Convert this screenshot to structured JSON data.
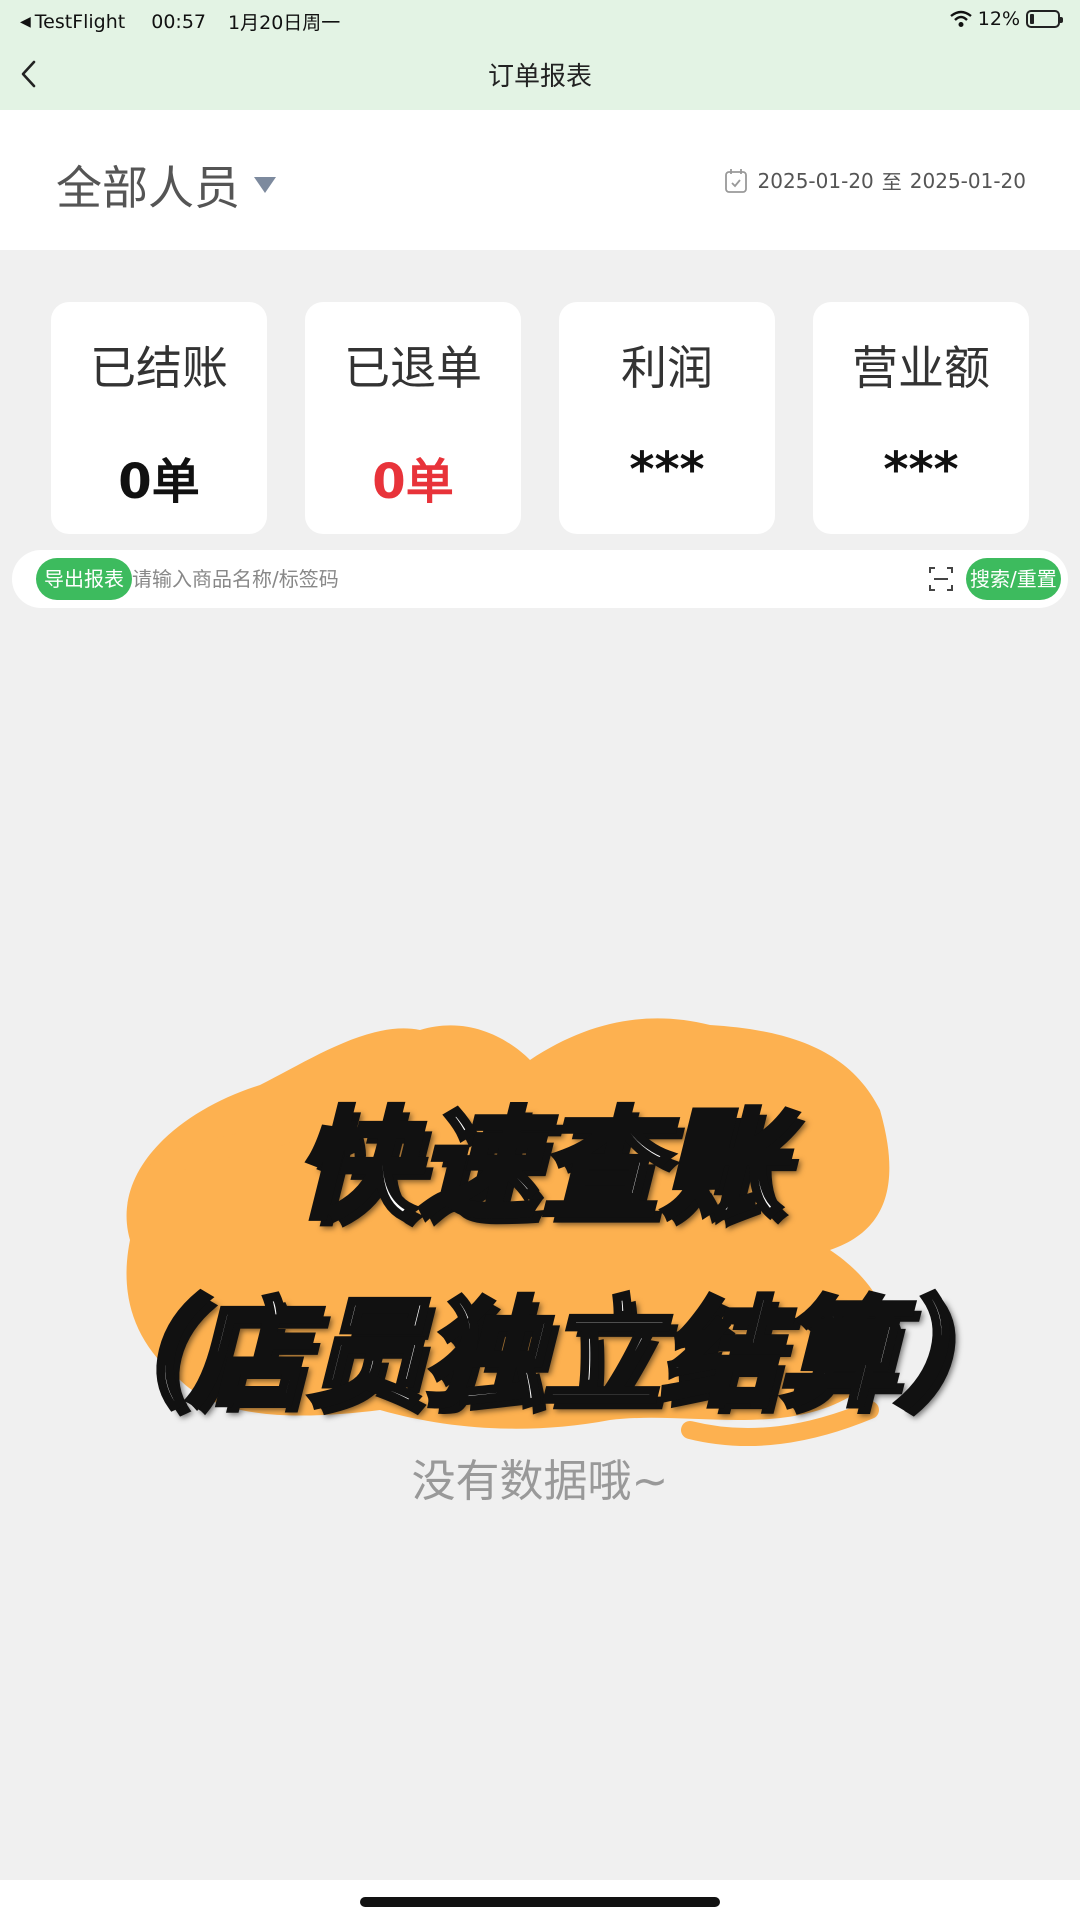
{
  "status_bar": {
    "app": "TestFlight",
    "time": "00:57",
    "date": "1月20日周一",
    "battery": "12%"
  },
  "nav": {
    "title": "订单报表"
  },
  "filter": {
    "staff": "全部人员",
    "date_from": "2025-01-20",
    "date_sep": "至",
    "date_to": "2025-01-20"
  },
  "stats": [
    {
      "title": "已结账",
      "value": "0单"
    },
    {
      "title": "已退单",
      "value": "0单"
    },
    {
      "title": "利润",
      "value": "***"
    },
    {
      "title": "营业额",
      "value": "***"
    }
  ],
  "search": {
    "export_label": "导出报表",
    "placeholder": "请输入商品名称/标签码",
    "value": "",
    "search_label": "搜索/重置"
  },
  "promo": {
    "line1": "快速查账",
    "line2": "（店员独立结算）"
  },
  "empty_text": "没有数据哦~",
  "colors": {
    "header_bg": "#e3f3e4",
    "accent_green": "#3dbb5e",
    "refund_red": "#e8333a",
    "promo_orange": "#fdb150"
  }
}
